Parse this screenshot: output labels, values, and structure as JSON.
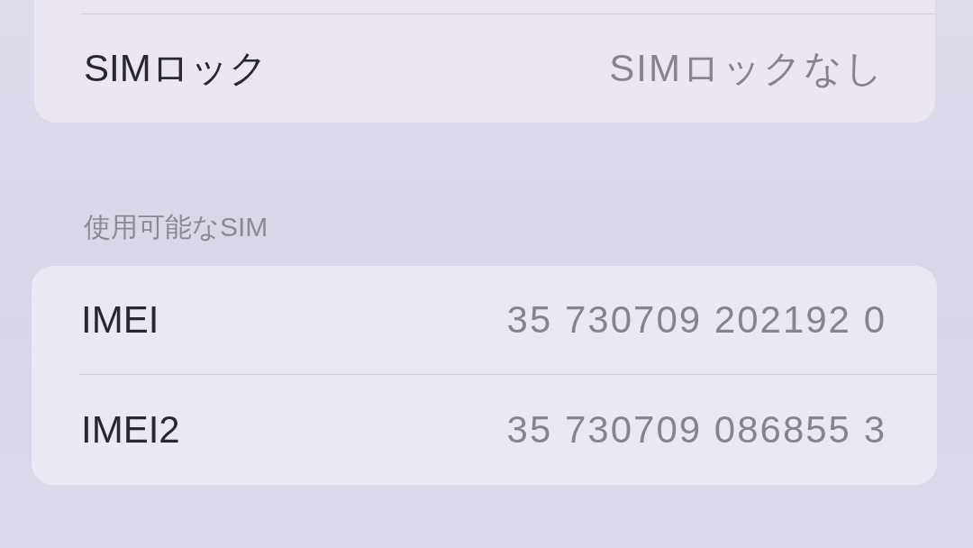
{
  "sections": [
    {
      "rows": [
        {
          "label": "SIMロック",
          "value": "SIMロックなし"
        }
      ]
    },
    {
      "header": "使用可能なSIM",
      "rows": [
        {
          "label": "IMEI",
          "value": "35 730709 202192 0"
        },
        {
          "label": "IMEI2",
          "value": "35 730709 086855 3"
        }
      ]
    }
  ]
}
